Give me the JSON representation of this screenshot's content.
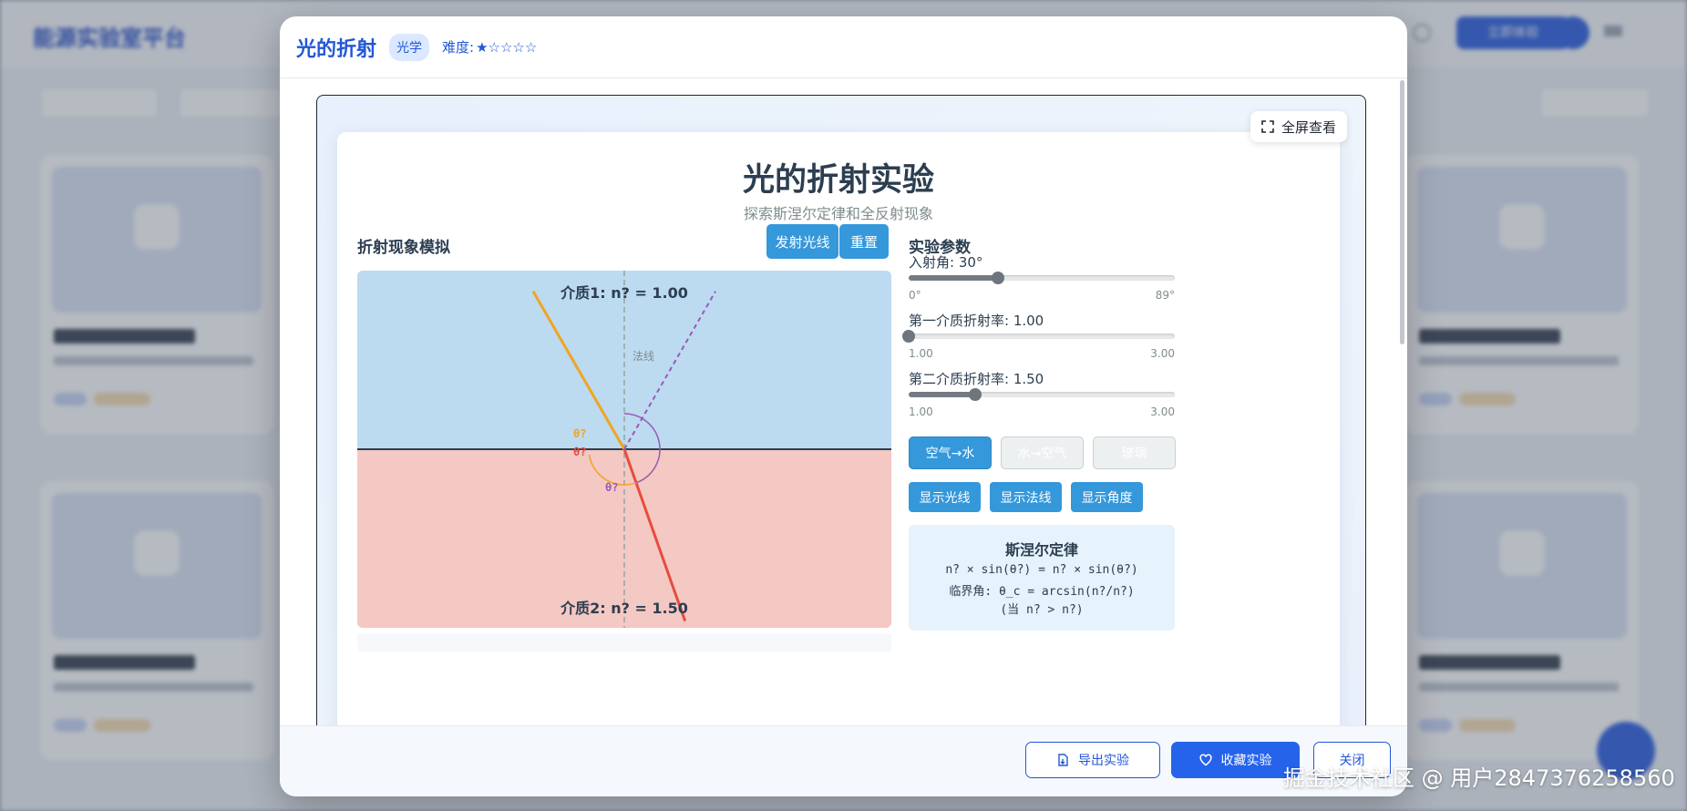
{
  "background": {
    "logo": "能源实验室平台",
    "signup_button": "立即体验",
    "user_initial": "",
    "cards": [
      "",
      "",
      "",
      ""
    ]
  },
  "modal": {
    "title": "光的折射",
    "category": "光学",
    "difficulty_label": "难度:",
    "difficulty_stars": "★☆☆☆☆",
    "fullscreen": "全屏查看",
    "lab": {
      "title": "光的折射实验",
      "subtitle": "探索斯涅尔定律和全反射现象",
      "sim_title": "折射现象模拟",
      "emit_button": "发射光线",
      "reset_button": "重置",
      "canvas": {
        "medium1_label": "介质1: n? = 1.00",
        "medium2_label": "介质2: n? = 1.50",
        "normal_label": "法线",
        "angle_incident": "θ?",
        "angle_refracted_left": "θ?",
        "angle_refracted": "θ?",
        "colors": {
          "medium1": "#bcdaf0",
          "medium2": "#f4c8c3",
          "incident_ray": "#f0a521",
          "refracted_ray": "#e74c3c",
          "reflected_ray": "#9b59b6",
          "interface": "#2c3e50"
        },
        "incidence_angle_deg": 30,
        "n1": 1.0,
        "n2": 1.5
      },
      "params_title": "实验参数",
      "sliders": [
        {
          "label": "入射角: 30°",
          "min_label": "0°",
          "max_label": "89°",
          "min": 0,
          "max": 89,
          "value": 30
        },
        {
          "label": "第一介质折射率: 1.00",
          "min_label": "1.00",
          "max_label": "3.00",
          "min": 1,
          "max": 3,
          "value": 1.0
        },
        {
          "label": "第二介质折射率: 1.50",
          "min_label": "1.00",
          "max_label": "3.00",
          "min": 1,
          "max": 3,
          "value": 1.5
        }
      ],
      "medium_buttons": [
        "空气→水",
        "水→空气",
        "玻璃"
      ],
      "toggle_buttons": [
        "显示光线",
        "显示法线",
        "显示角度"
      ],
      "law": {
        "title": "斯涅尔定律",
        "formula": "n? × sin(θ?) = n? × sin(θ?)",
        "critical": "临界角: θ_c = arcsin(n?/n?)",
        "condition": "(当 n? > n?)"
      }
    },
    "footer": {
      "export": "导出实验",
      "favorite": "收藏实验",
      "close": "关闭"
    }
  },
  "watermark": "掘金技术社区 @ 用户2847376258560"
}
